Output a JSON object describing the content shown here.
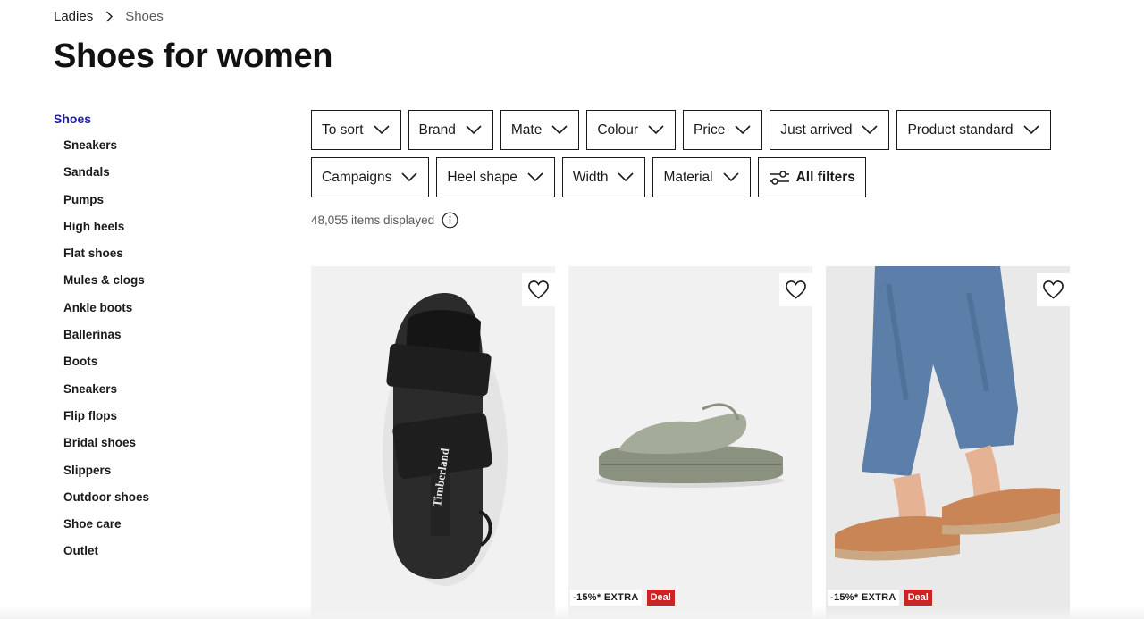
{
  "breadcrumb": {
    "parent": "Ladies",
    "current": "Shoes"
  },
  "title": "Shoes for women",
  "sidebar": {
    "root": "Shoes",
    "items": [
      "Sneakers",
      "Sandals",
      "Pumps",
      "High heels",
      "Flat shoes",
      "Mules & clogs",
      "Ankle boots",
      "Ballerinas",
      "Boots",
      "Sneakers",
      "Flip flops",
      "Bridal shoes",
      "Slippers",
      "Outdoor shoes",
      "Shoe care",
      "Outlet"
    ]
  },
  "filters": {
    "row1": [
      "To sort",
      "Brand",
      "Mate",
      "Colour",
      "Price",
      "Just arrived",
      "Product standard"
    ],
    "row2": [
      "Campaigns",
      "Heel shape",
      "Width",
      "Material"
    ],
    "all_filters": "All filters"
  },
  "results": {
    "count_text": "48,055 items displayed"
  },
  "products": [
    {
      "badge_extra": "",
      "badge_deal": ""
    },
    {
      "badge_extra": "-15%* EXTRA",
      "badge_deal": "Deal"
    },
    {
      "badge_extra": "-15%* EXTRA",
      "badge_deal": "Deal"
    }
  ],
  "product_logo_text": "Timberland",
  "colors": {
    "accent": "#1f1ab4",
    "deal": "#cc2323",
    "card_bg": "#efefef"
  },
  "icons": {
    "chevron": "chevron-down-icon",
    "favorite": "heart-outline-icon",
    "info": "info-circle-icon",
    "filters": "sliders-icon",
    "breadcrumb_sep": "chevron-right-icon"
  }
}
